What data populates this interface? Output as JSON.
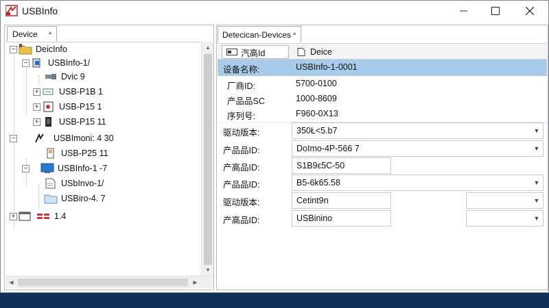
{
  "window": {
    "title": "USBInfo"
  },
  "left_pane": {
    "tab": "Device",
    "tree": [
      {
        "label": "DeicInfo",
        "icon": "folder-icon"
      },
      {
        "label": "USBInfo-1/",
        "icon": "usb-port-icon"
      },
      {
        "label": "Dvic 9",
        "icon": "usb-plug-icon"
      },
      {
        "label": "USB-P1B 1",
        "icon": "connector-icon"
      },
      {
        "label": "USB-P15 1",
        "icon": "device-box-icon"
      },
      {
        "label": "USB-P15 11",
        "icon": "chip-icon"
      },
      {
        "label": "USBImoni: 4 30",
        "icon": "usb-logo-icon"
      },
      {
        "label": "USB-P25 11",
        "icon": "flash-drive-icon"
      },
      {
        "label": "USBInfo-1 -7",
        "icon": "monitor-icon"
      },
      {
        "label": "USbInvo-1/",
        "icon": "document-icon"
      },
      {
        "label": "USBiro-4. 7",
        "icon": "folder-icon"
      },
      {
        "label": "1.4",
        "icon": "window-icon"
      }
    ]
  },
  "right_pane": {
    "tab": "Detecican-Devices",
    "subtabs": [
      {
        "label": "汽高Id",
        "icon": "device-card-icon"
      },
      {
        "label": "Deice",
        "icon": "page-icon"
      }
    ],
    "properties": [
      {
        "label": "设备名称:",
        "value": "USBInfo-1-0001"
      },
      {
        "label": "厂商ID:",
        "value": "5700-0100"
      },
      {
        "label": "产品品SC",
        "value": "1000-8609"
      },
      {
        "label": "序列号:",
        "value": "F960-0X13"
      },
      {
        "label": "驱动版本:",
        "value": "350Ł<5.b7"
      },
      {
        "label": "产品品ID:",
        "value": "DoImo-4P-566  7"
      },
      {
        "label": "产高品ID:",
        "value": "S1B9ε5C-50"
      },
      {
        "label": "产品品ID:",
        "value": "B5-6k65.58"
      },
      {
        "label": "驱动版本:",
        "value": "Cetint9n"
      },
      {
        "label": "产高品ID:",
        "value": "USBinino"
      }
    ]
  },
  "colors": {
    "selection": "#a9cbeb",
    "desktop": "#1d4c86"
  }
}
